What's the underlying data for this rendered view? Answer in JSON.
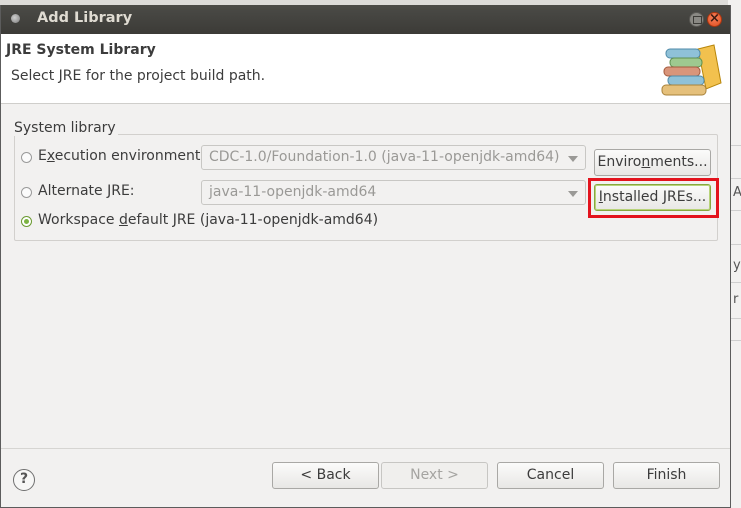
{
  "window": {
    "title": "Add Library"
  },
  "header": {
    "title": "JRE System Library",
    "message": "Select JRE for the project build path."
  },
  "group": {
    "label": "System library",
    "execution_env": {
      "label_pre": "E",
      "label_ul": "x",
      "label_post": "ecution environment:",
      "selected": false,
      "combo_value": "CDC-1.0/Foundation-1.0 (java-11-openjdk-amd64)",
      "button_pre": "Enviro",
      "button_ul": "n",
      "button_post": "ments..."
    },
    "alternate_jre": {
      "label": "Alternate JRE:",
      "selected": false,
      "combo_value": "java-11-openjdk-amd64",
      "button_pre": "",
      "button_ul": "I",
      "button_post": "nstalled JREs..."
    },
    "workspace_default": {
      "label_pre": "Workspace ",
      "label_ul": "d",
      "label_post": "efault JRE (java-11-openjdk-amd64)",
      "selected": true
    }
  },
  "footer": {
    "help_glyph": "?",
    "back": "< Back",
    "next": "Next >",
    "cancel": "Cancel",
    "finish": "Finish"
  },
  "background_fragments": [
    "A",
    "y",
    "r"
  ],
  "colors": {
    "highlight": "#e3131d",
    "radio_selected": "#7cb342"
  }
}
